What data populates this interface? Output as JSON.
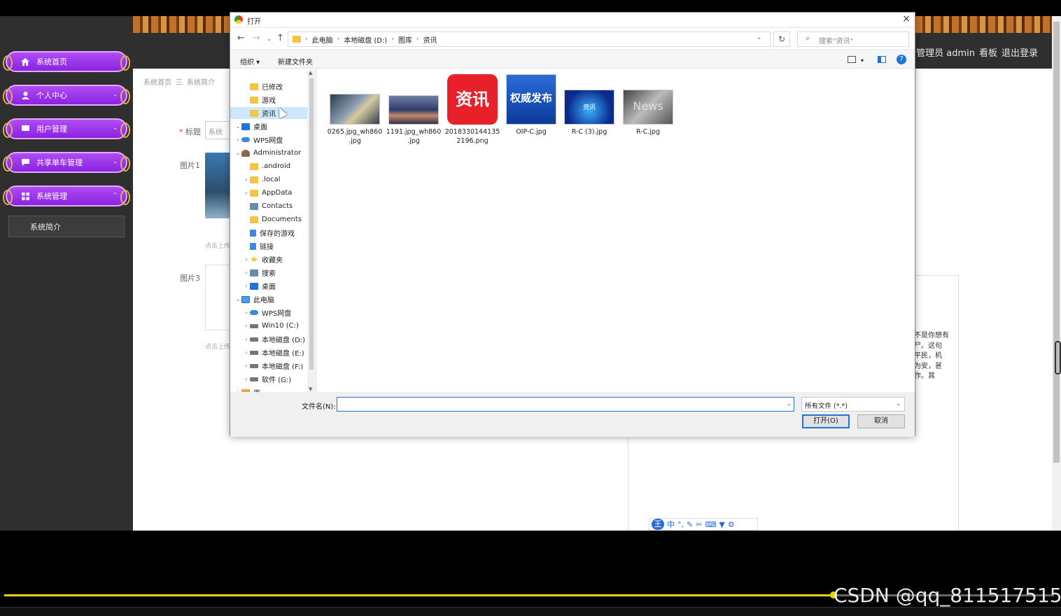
{
  "sidebar": {
    "items": [
      {
        "label": "系统首页",
        "icon": "home-icon"
      },
      {
        "label": "个人中心",
        "icon": "person-icon"
      },
      {
        "label": "用户管理",
        "icon": "card-icon"
      },
      {
        "label": "共享单车管理",
        "icon": "chat-icon"
      },
      {
        "label": "系统管理",
        "icon": "grid-icon"
      }
    ],
    "sub_item": "系统简介"
  },
  "header": {
    "user": "管理员 admin",
    "board": "看板",
    "logout": "退出登录"
  },
  "breadcrumb": {
    "home": "系统首页",
    "separator": "三",
    "current": "系统简介"
  },
  "form": {
    "title_label": "标题",
    "title_value": "系统",
    "image1_label": "图片1",
    "image3_label": "图片3",
    "upload_hint": "点击上传"
  },
  "editor": {
    "text_lines": [
      "不是你想有",
      "尸。这句",
      "平民，机",
      "为安，甚",
      "作。其"
    ]
  },
  "ime": {
    "logo": "王",
    "mode": "中",
    "punct": "°,"
  },
  "dialog": {
    "title": "打开",
    "close": "×",
    "path": [
      "此电脑",
      "本地磁盘 (D:)",
      "图库",
      "资讯"
    ],
    "search_placeholder": "搜索\"资讯\"",
    "organize": "组织 ▾",
    "new_folder": "新建文件夹",
    "tree": [
      {
        "label": "已修改",
        "icon": "folder",
        "indent": 1,
        "toggle": ""
      },
      {
        "label": "游戏",
        "icon": "folder",
        "indent": 1,
        "toggle": ""
      },
      {
        "label": "资讯",
        "icon": "folder",
        "indent": 1,
        "toggle": "",
        "selected": true
      },
      {
        "label": "桌面",
        "icon": "desk",
        "indent": 0,
        "toggle": "v"
      },
      {
        "label": "WPS网盘",
        "icon": "cloud",
        "indent": 0,
        "toggle": ">"
      },
      {
        "label": "Administrator",
        "icon": "user",
        "indent": 0,
        "toggle": "v"
      },
      {
        "label": ".android",
        "icon": "folder",
        "indent": 1,
        "toggle": ""
      },
      {
        "label": ".local",
        "icon": "folder",
        "indent": 1,
        "toggle": ">"
      },
      {
        "label": "AppData",
        "icon": "folder",
        "indent": 1,
        "toggle": ">"
      },
      {
        "label": "Contacts",
        "icon": "contacts",
        "indent": 1,
        "toggle": ""
      },
      {
        "label": "Documents",
        "icon": "folder",
        "indent": 1,
        "toggle": ""
      },
      {
        "label": "保存的游戏",
        "icon": "link",
        "indent": 1,
        "toggle": ""
      },
      {
        "label": "链接",
        "icon": "link",
        "indent": 1,
        "toggle": ""
      },
      {
        "label": "收藏夹",
        "icon": "star",
        "indent": 1,
        "toggle": ">"
      },
      {
        "label": "搜索",
        "icon": "contacts",
        "indent": 1,
        "toggle": ">"
      },
      {
        "label": "桌面",
        "icon": "desk",
        "indent": 1,
        "toggle": ">"
      },
      {
        "label": "此电脑",
        "icon": "pc",
        "indent": 0,
        "toggle": "v"
      },
      {
        "label": "WPS网盘",
        "icon": "cloud",
        "indent": 1,
        "toggle": ">"
      },
      {
        "label": "Win10 (C:)",
        "icon": "drive",
        "indent": 1,
        "toggle": ">"
      },
      {
        "label": "本地磁盘 (D:)",
        "icon": "drive",
        "indent": 1,
        "toggle": ">"
      },
      {
        "label": "本地磁盘 (E:)",
        "icon": "drive",
        "indent": 1,
        "toggle": ">"
      },
      {
        "label": "本地磁盘 (F:)",
        "icon": "drive",
        "indent": 1,
        "toggle": ">"
      },
      {
        "label": "软件 (G:)",
        "icon": "drive",
        "indent": 1,
        "toggle": ">"
      },
      {
        "label": "库",
        "icon": "lib",
        "indent": 0,
        "toggle": ">"
      }
    ],
    "files": [
      {
        "name": "0265.jpg_wh860.jpg",
        "line1": "0265.jpg_wh860",
        "line2": ".jpg",
        "thumb_text": ""
      },
      {
        "name": "1191.jpg_wh860.jpg",
        "line1": "1191.jpg_wh860",
        "line2": ".jpg",
        "thumb_text": ""
      },
      {
        "name": "20183301441352196.png",
        "line1": "2018330144135",
        "line2": "2196.png",
        "thumb_text": "资讯"
      },
      {
        "name": "OIP-C.jpg",
        "line1": "OIP-C.jpg",
        "line2": "",
        "thumb_text": "权威发布"
      },
      {
        "name": "R-C (3).jpg",
        "line1": "R-C (3).jpg",
        "line2": "",
        "thumb_text": "资讯"
      },
      {
        "name": "R-C.jpg",
        "line1": "R-C.jpg",
        "line2": "",
        "thumb_text": "News"
      }
    ],
    "filename_label": "文件名(N):",
    "filename_value": "",
    "filetype": "所有文件 (*.*)",
    "open_button": "打开(O)",
    "cancel_button": "取消"
  },
  "player": {
    "watermark": "CSDN @qq_811517515",
    "progress": 0.79
  }
}
